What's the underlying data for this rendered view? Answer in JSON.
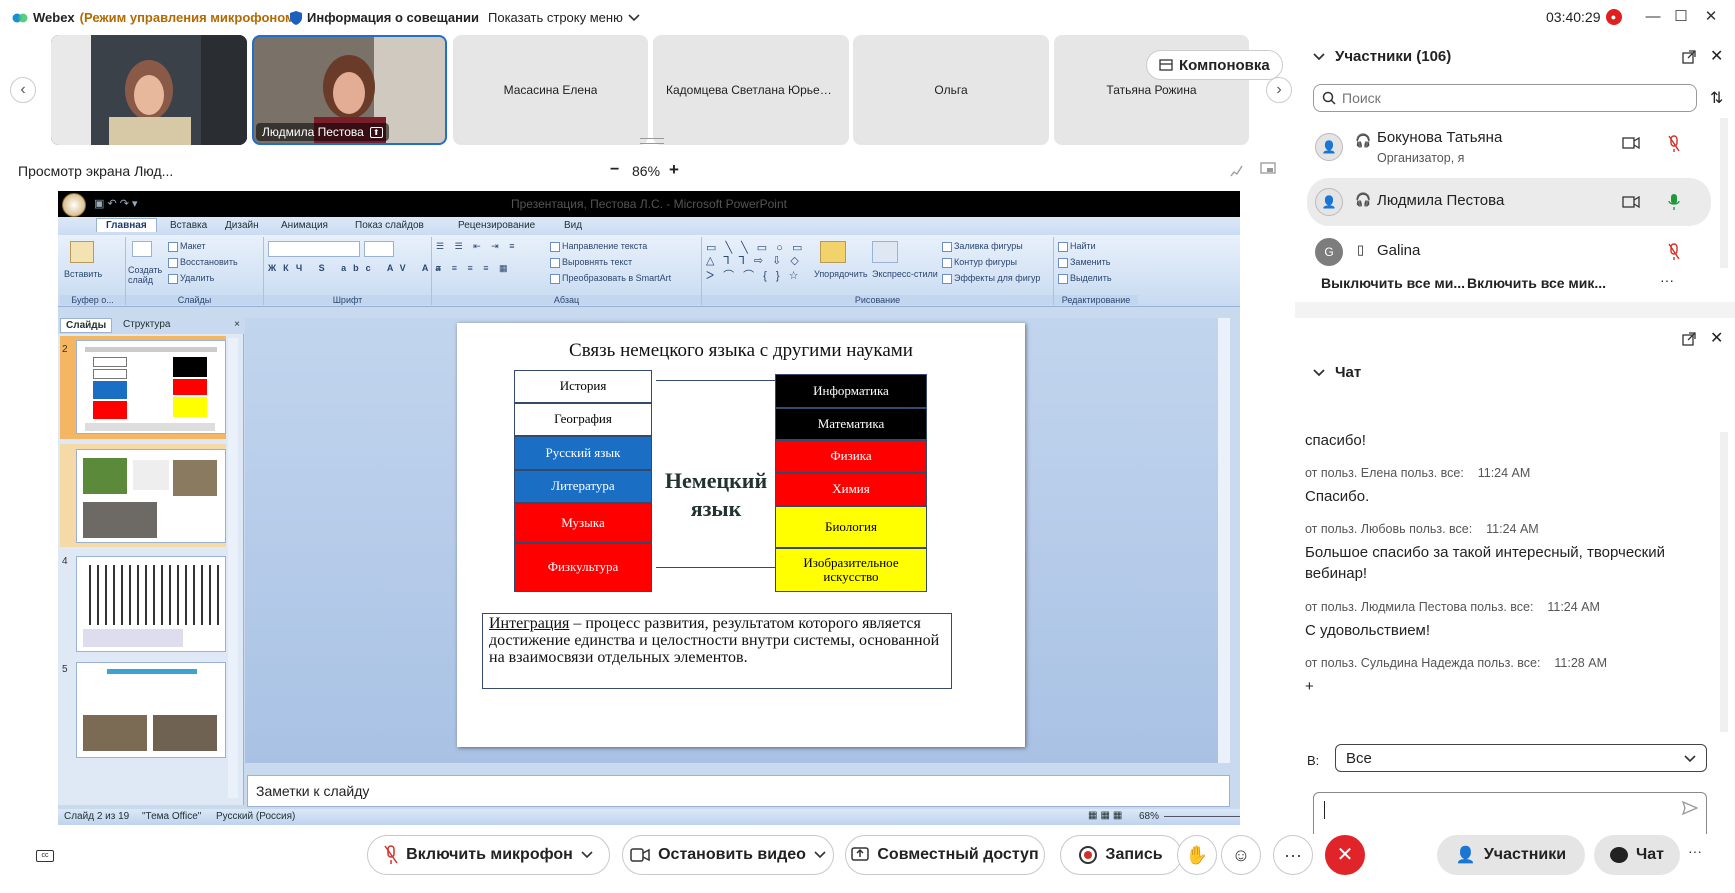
{
  "titlebar": {
    "app_name": "Webex",
    "mode": "(Режим управления микрофоном)",
    "meeting_info": "Информация о совещании",
    "show_menu": "Показать строку меню",
    "time": "03:40:29"
  },
  "video_strip": {
    "tiles": [
      {
        "name": ""
      },
      {
        "name": "Людмила Пестова"
      },
      {
        "name": "Масасина Елена"
      },
      {
        "name": "Кадомцева Светлана Юрьев..."
      },
      {
        "name": "Ольга"
      },
      {
        "name": "Татьяна Рожина"
      }
    ],
    "layout_button": "Компоновка"
  },
  "screen_share": {
    "label": "Просмотр экрана Люд...",
    "zoom_minus": "−",
    "zoom": "86%",
    "zoom_plus": "+"
  },
  "powerpoint": {
    "window_title": "Презентация, Пестова Л.С. - Microsoft PowerPoint",
    "tabs": [
      "Главная",
      "Вставка",
      "Дизайн",
      "Анимация",
      "Показ слайдов",
      "Рецензирование",
      "Вид"
    ],
    "groups": {
      "clipboard": "Буфер о...",
      "slides": "Слайды",
      "font": "Шрифт",
      "paragraph": "Абзац",
      "drawing": "Рисование",
      "editing": "Редактирование"
    },
    "buttons": {
      "paste": "Вставить",
      "create_slide": "Создать слайд",
      "layout": "Макет",
      "reset": "Восстановить",
      "delete": "Удалить",
      "text_direction": "Направление текста",
      "align_text": "Выровнять текст",
      "smartart": "Преобразовать в SmartArt",
      "arrange": "Упорядочить",
      "quick_styles": "Экспресс-стили",
      "fill": "Заливка фигуры",
      "outline": "Контур фигуры",
      "effects": "Эффекты для фигур",
      "find": "Найти",
      "replace": "Заменить",
      "select": "Выделить"
    },
    "side_tabs": [
      "Слайды",
      "Структура"
    ],
    "thumb_numbers": [
      "2",
      "3",
      "4",
      "5"
    ],
    "slide": {
      "title": "Связь немецкого языка с другими науками",
      "center": "Немецкий язык",
      "left_boxes": [
        {
          "label": "История",
          "color": "#ffffff",
          "text_color": "#000000"
        },
        {
          "label": "География",
          "color": "#ffffff",
          "text_color": "#000000"
        },
        {
          "label": "Русский язык",
          "color": "#1a6fc4",
          "text_color": "#ffffff"
        },
        {
          "label": "Литература",
          "color": "#1a6fc4",
          "text_color": "#ffffff"
        },
        {
          "label": "Музыка",
          "color": "#ff0000",
          "text_color": "#ffffff"
        },
        {
          "label": "Физкультура",
          "color": "#ff0000",
          "text_color": "#ffffff"
        }
      ],
      "right_boxes": [
        {
          "label": "Информатика",
          "color": "#000000",
          "text_color": "#ffffff"
        },
        {
          "label": "Математика",
          "color": "#000000",
          "text_color": "#ffffff"
        },
        {
          "label": "Физика",
          "color": "#ff0000",
          "text_color": "#ffffff"
        },
        {
          "label": "Химия",
          "color": "#ff0000",
          "text_color": "#ffffff"
        },
        {
          "label": "Биология",
          "color": "#ffff00",
          "text_color": "#000000"
        },
        {
          "label": "Изобразительное искусство",
          "color": "#ffff00",
          "text_color": "#000000"
        }
      ],
      "definition_term": "Интеграция",
      "definition_text": " – процесс развития, результатом которого является достижение единства и целостности внутри системы, основанной на взаимосвязи отдельных элементов."
    },
    "notes_placeholder": "Заметки к слайду",
    "status": {
      "slide_of": "Слайд 2 из 19",
      "theme": "\"Тема Office\"",
      "language": "Русский (Россия)",
      "zoom": "68%"
    }
  },
  "participants": {
    "title": "Участники (106)",
    "search_placeholder": "Поиск",
    "list": [
      {
        "name": "Бокунова Татьяна",
        "role": "Организатор, я"
      },
      {
        "name": "Людмила Пестова",
        "role": ""
      },
      {
        "name": "Galina",
        "role": "",
        "initial": "G"
      }
    ],
    "mute_all": "Выключить все ми...",
    "unmute_all": "Включить все мик...",
    "more": "···"
  },
  "chat": {
    "title": "Чат",
    "messages": [
      {
        "meta": "",
        "time": "",
        "text": "спасибо!"
      },
      {
        "meta": "от польз. Елена польз. все:",
        "time": "11:24 AM",
        "text": "Спасибо."
      },
      {
        "meta": "от польз. Любовь польз. все:",
        "time": "11:24 AM",
        "text": "Большое спасибо за такой интересный, творческий вебинар!"
      },
      {
        "meta": "от польз. Людмила Пестова польз. все:",
        "time": "11:24 AM",
        "text": "С удовольствием!"
      },
      {
        "meta": "от польз. Сульдина Надежда польз. все:",
        "time": "11:28 AM",
        "text": "+"
      }
    ],
    "to_label": "В:",
    "to_value": "Все"
  },
  "bottom_bar": {
    "unmute": "Включить микрофон",
    "stop_video": "Остановить видео",
    "share": "Совместный доступ",
    "record": "Запись",
    "participants": "Участники",
    "chat": "Чат",
    "more": "···"
  }
}
